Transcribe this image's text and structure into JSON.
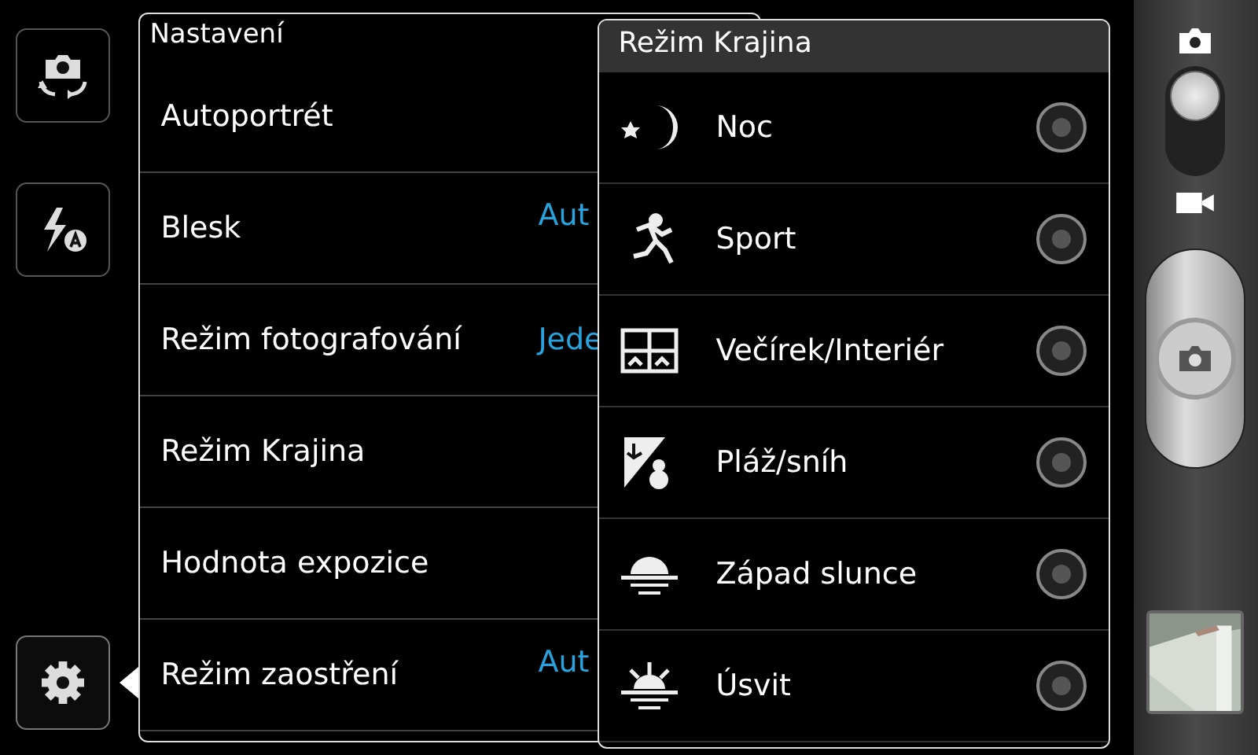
{
  "left_rail": [
    {
      "kind": "switch_camera",
      "selected": false
    },
    {
      "kind": "flash",
      "selected": false
    },
    {
      "kind": "settings",
      "selected": true
    }
  ],
  "settings": {
    "title": "Nastavení",
    "items": [
      {
        "label": "Autoportrét"
      },
      {
        "label": "Blesk",
        "value": "Aut"
      },
      {
        "label": "Režim fotografování",
        "value": "Jede"
      },
      {
        "label": "Režim Krajina"
      },
      {
        "label": "Hodnota expozice"
      },
      {
        "label": "Režim zaostření",
        "value": "Aut"
      }
    ]
  },
  "popup": {
    "title": "Režim Krajina",
    "options": [
      {
        "kind": "night",
        "label": "Noc",
        "selected": false
      },
      {
        "kind": "sport",
        "label": "Sport",
        "selected": false
      },
      {
        "kind": "party",
        "label": "Večírek/Interiér",
        "selected": false
      },
      {
        "kind": "beach",
        "label": "Pláž/sníh",
        "selected": false
      },
      {
        "kind": "sunset",
        "label": "Západ slunce",
        "selected": false
      },
      {
        "kind": "dawn",
        "label": "Úsvit",
        "selected": false
      }
    ]
  },
  "mode_switch": {
    "video": false
  }
}
